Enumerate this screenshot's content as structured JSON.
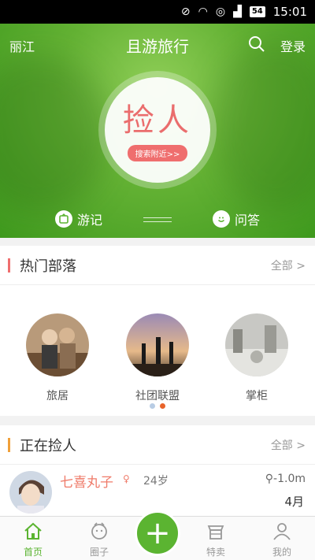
{
  "status_bar": {
    "time": "15:01",
    "battery": "54"
  },
  "header": {
    "city": "丽江",
    "title": "且游旅行",
    "login": "登录"
  },
  "hero": {
    "circle_title": "捡人",
    "circle_button": "搜索附近>>"
  },
  "hero_tabs": {
    "travel": "游记",
    "qa": "问答"
  },
  "hot_tribes": {
    "title": "热门部落",
    "more": "全部 >",
    "items": [
      {
        "name": "旅居"
      },
      {
        "name": "社团联盟"
      },
      {
        "name": "掌柜"
      }
    ],
    "page_count": 2,
    "active_page": 2
  },
  "picking": {
    "title": "正在捡人",
    "more": "全部 >",
    "entry": {
      "name": "七喜丸子",
      "age": "24岁",
      "distance": "-1.0m",
      "month": "4月"
    }
  },
  "bottom_nav": {
    "home": "首页",
    "circle": "圈子",
    "special": "特卖",
    "mine": "我的",
    "add": "+"
  },
  "colors": {
    "brand_green": "#5bb431",
    "accent_red": "#ef6e6e",
    "accent_orange": "#f0a03a"
  }
}
